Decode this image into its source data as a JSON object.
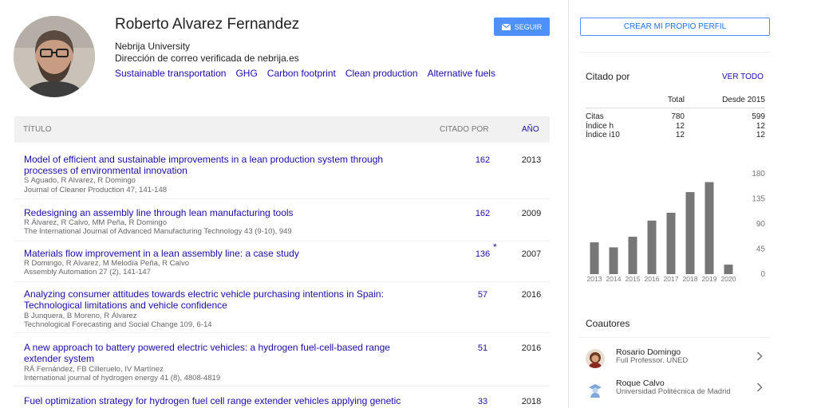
{
  "profile": {
    "name": "Roberto Alvarez Fernandez",
    "affiliation": "Nebrija University",
    "email": "Dirección de correo verificada de nebrija.es",
    "interests": [
      "Sustainable transportation",
      "GHG",
      "Carbon footprint",
      "Clean production",
      "Alternative fuels"
    ],
    "follow_label": "SEGUIR"
  },
  "table": {
    "headers": {
      "title": "TÍTULO",
      "cited": "CITADO POR",
      "year": "AÑO"
    },
    "rows": [
      {
        "title": "Model of efficient and sustainable improvements in a lean production system through processes of environmental innovation",
        "authors": "S Aguado, R Alvarez, R Domingo",
        "venue": "Journal of Cleaner Production 47, 141-148",
        "cites": "162",
        "star": "",
        "year": "2013"
      },
      {
        "title": "Redesigning an assembly line through lean manufacturing tools",
        "authors": "R Álvarez, R Calvo, MM Peña, R Domingo",
        "venue": "The International Journal of Advanced Manufacturing Technology 43 (9-10), 949",
        "cites": "162",
        "star": "",
        "year": "2009"
      },
      {
        "title": "Materials flow improvement in a lean assembly line: a case study",
        "authors": "R Domingo, R Alvarez, M Melodía Peña, R Calvo",
        "venue": "Assembly Automation 27 (2), 141-147",
        "cites": "136",
        "star": "*",
        "year": "2007"
      },
      {
        "title": "Analyzing consumer attitudes towards electric vehicle purchasing intentions in Spain: Technological limitations and vehicle confidence",
        "authors": "B Junquera, B Moreno, R Álvarez",
        "venue": "Technological Forecasting and Social Change 109, 6-14",
        "cites": "57",
        "star": "",
        "year": "2016"
      },
      {
        "title": "A new approach to battery powered electric vehicles: a hydrogen fuel-cell-based range extender system",
        "authors": "RÁ Fernández, FB Cilleruelo, IV Martínez",
        "venue": "International journal of hydrogen energy 41 (8), 4808-4819",
        "cites": "51",
        "star": "",
        "year": "2016"
      },
      {
        "title": "Fuel optimization strategy for hydrogen fuel cell range extender vehicles applying genetic",
        "authors": "",
        "venue": "",
        "cites": "33",
        "star": "",
        "year": "2018"
      }
    ]
  },
  "sidebar": {
    "create_label": "CREAR MI PROPIO PERFIL",
    "cited_by_label": "Citado por",
    "view_all_label": "VER TODO",
    "stats": {
      "col_total": "Total",
      "col_since": "Desde 2015",
      "rows": [
        {
          "label": "Citas",
          "total": "780",
          "since": "599"
        },
        {
          "label": "Índice h",
          "total": "12",
          "since": "12"
        },
        {
          "label": "Índice i10",
          "total": "12",
          "since": "12"
        }
      ]
    },
    "coauthors_label": "Coautores",
    "coauthors": [
      {
        "name": "Rosario Domingo",
        "affiliation": "Full Professor. UNED"
      },
      {
        "name": "Roque Calvo",
        "affiliation": "Universidad Politécnica de Madrid"
      }
    ]
  },
  "chart_data": {
    "type": "bar",
    "categories": [
      "2013",
      "2014",
      "2015",
      "2016",
      "2017",
      "2018",
      "2019",
      "2020"
    ],
    "values": [
      57,
      48,
      67,
      96,
      110,
      147,
      165,
      17
    ],
    "yticks": [
      "180",
      "135",
      "90",
      "45",
      "0"
    ],
    "ylim": [
      0,
      180
    ],
    "bar_color": "#777777"
  }
}
